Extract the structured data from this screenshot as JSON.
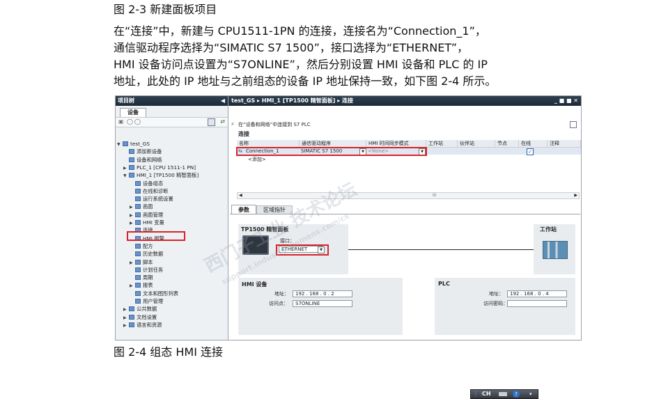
{
  "figure_caption_top": "图 2-3 新建面板项目",
  "paragraph_lines": [
    "在“连接”中，新建与 CPU1511-1PN 的连接，连接名为“Connection_1”，",
    "通信驱动程序选择为“SIMATIC S7 1500”，接口选择为“ETHERNET”，",
    "HMI 设备访问点设置为“S7ONLINE”，然后分别设置 HMI 设备和 PLC 的 IP",
    "地址，此处的 IP 地址与之前组态的设备 IP 地址保持一致，如下图 2-4 所示。"
  ],
  "figure_caption_bottom": "图 2-4  组态 HMI 连接",
  "screenshot": {
    "left_panel": {
      "title": "项目树",
      "tab": "设备",
      "tree": [
        {
          "label": "test_GS",
          "indent": 0,
          "arrow": "▼"
        },
        {
          "label": "添加新设备",
          "indent": 1,
          "arrow": ""
        },
        {
          "label": "设备和网络",
          "indent": 1,
          "arrow": ""
        },
        {
          "label": "PLC_1 [CPU 1511-1 PN]",
          "indent": 1,
          "arrow": "▶"
        },
        {
          "label": "HMI_1 [TP1500 精智面板]",
          "indent": 1,
          "arrow": "▼"
        },
        {
          "label": "设备组态",
          "indent": 2,
          "arrow": ""
        },
        {
          "label": "在线和诊断",
          "indent": 2,
          "arrow": ""
        },
        {
          "label": "运行系统设置",
          "indent": 2,
          "arrow": ""
        },
        {
          "label": "画面",
          "indent": 2,
          "arrow": "▶"
        },
        {
          "label": "画面管理",
          "indent": 2,
          "arrow": "▶"
        },
        {
          "label": "HMI 变量",
          "indent": 2,
          "arrow": "▶"
        },
        {
          "label": "连接",
          "indent": 2,
          "arrow": ""
        },
        {
          "label": "HMI 报警",
          "indent": 2,
          "arrow": ""
        },
        {
          "label": "配方",
          "indent": 2,
          "arrow": ""
        },
        {
          "label": "历史数据",
          "indent": 2,
          "arrow": ""
        },
        {
          "label": "脚本",
          "indent": 2,
          "arrow": "▶"
        },
        {
          "label": "计划任务",
          "indent": 2,
          "arrow": ""
        },
        {
          "label": "周期",
          "indent": 2,
          "arrow": ""
        },
        {
          "label": "报表",
          "indent": 2,
          "arrow": "▶"
        },
        {
          "label": "文本和图形列表",
          "indent": 2,
          "arrow": ""
        },
        {
          "label": "用户管理",
          "indent": 2,
          "arrow": ""
        },
        {
          "label": "公共数据",
          "indent": 1,
          "arrow": "▶"
        },
        {
          "label": "文档设置",
          "indent": 1,
          "arrow": "▶"
        },
        {
          "label": "语言和资源",
          "indent": 1,
          "arrow": "▶"
        }
      ]
    },
    "breadcrumb": "test_GS  ▸  HMI_1 [TP1500 精智面板]  ▸  连接",
    "window_controls": "_ ■ ■ ✕",
    "toolbar_text": "在“设备和网络”中连接到 S7 PLC",
    "section_title": "连接",
    "table": {
      "headers": [
        "名称",
        "通信驱动程序",
        "HMI 时间同步模式",
        "工作站",
        "伙伴站",
        "节点",
        "在线",
        "注释"
      ],
      "row": {
        "name": "Connection_1",
        "driver": "SIMATIC S7 1500",
        "sync": "<None>"
      },
      "add_row": "<添加>"
    },
    "scroll_label": "III",
    "tabs": [
      "参数",
      "区域指针"
    ],
    "params": {
      "device_title": "TP1500 精智面板",
      "interface_label": "接口：",
      "interface_value": "ETHERNET",
      "station_title": "工作站",
      "hmi_section": "HMI 设备",
      "plc_section": "PLC",
      "hmi_address_label": "地址：",
      "hmi_address": "192 . 168 . 0    . 2",
      "access_point_label": "访问点：",
      "access_point": "S7ONLINE",
      "plc_address_label": "地址：",
      "plc_address": "192 . 168 . 0    . 4",
      "password_label": "访问密码："
    },
    "watermark": "西门子工业  技术论坛",
    "watermark_url": "support.industry.siemens.com/cs"
  },
  "taskbar_text": "CH"
}
